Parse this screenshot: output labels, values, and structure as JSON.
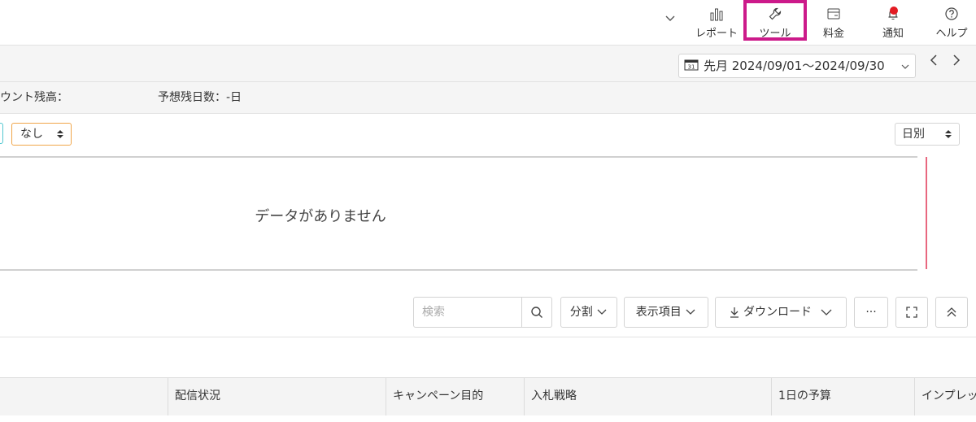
{
  "header": {
    "nav": [
      {
        "key": "report",
        "label": "レポート",
        "icon": "bar-chart-icon"
      },
      {
        "key": "tools",
        "label": "ツール",
        "icon": "wrench-icon"
      },
      {
        "key": "billing",
        "label": "料金",
        "icon": "wallet-icon"
      },
      {
        "key": "notifications",
        "label": "通知",
        "icon": "bell-icon"
      },
      {
        "key": "help",
        "label": "ヘルプ",
        "icon": "question-icon"
      }
    ],
    "highlight_color": "#cc1a8a",
    "notification_dot_color": "#e31b23"
  },
  "date_range": {
    "label": "先月 2024/09/01〜2024/09/30",
    "prev": "〈",
    "next": "〉"
  },
  "account_info": {
    "balance_label": "ウント残高：",
    "estimate_label": "予想残日数：-日"
  },
  "filters": {
    "compare": "なし",
    "granularity": "日別"
  },
  "chart": {
    "empty_message": "データがありません"
  },
  "toolbar": {
    "search_placeholder": "検索",
    "split_label": "分割",
    "columns_label": "表示項目",
    "download_label": "ダウンロード",
    "more_label": "···"
  },
  "table": {
    "columns": [
      "配信状況",
      "キャンペーン目的",
      "入札戦略",
      "1日の予算",
      "インプレッ"
    ]
  }
}
